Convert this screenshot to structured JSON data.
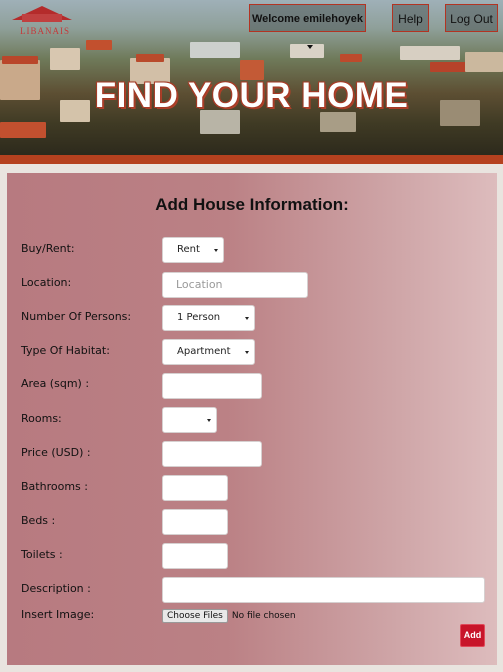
{
  "logo": {
    "text": "LIBANAIS"
  },
  "nav": {
    "welcome_label": "Welcome emilehoyek",
    "help_label": "Help",
    "logout_label": "Log Out"
  },
  "hero": {
    "title": "FIND YOUR HOME"
  },
  "form": {
    "title": "Add House Information:",
    "fields": {
      "buy_rent": {
        "label": "Buy/Rent:",
        "value": "Rent"
      },
      "location": {
        "label": "Location:",
        "placeholder": "Location"
      },
      "persons": {
        "label": "Number Of Persons:",
        "value": "1 Person"
      },
      "habitat": {
        "label": "Type Of Habitat:",
        "value": "Apartment"
      },
      "area": {
        "label": "Area (sqm) :"
      },
      "rooms": {
        "label": "Rooms:",
        "value": ""
      },
      "price": {
        "label": "Price (USD) :"
      },
      "bathrooms": {
        "label": "Bathrooms :"
      },
      "beds": {
        "label": "Beds :"
      },
      "toilets": {
        "label": "Toilets :"
      },
      "description": {
        "label": "Description :"
      },
      "image": {
        "label": "Insert Image:",
        "button": "Choose Files",
        "status": "No file chosen"
      }
    },
    "submit_label": "Add"
  },
  "colors": {
    "accent_red": "#b5411f",
    "button_red": "#c8152a",
    "panel_rose": "#bb8185"
  }
}
